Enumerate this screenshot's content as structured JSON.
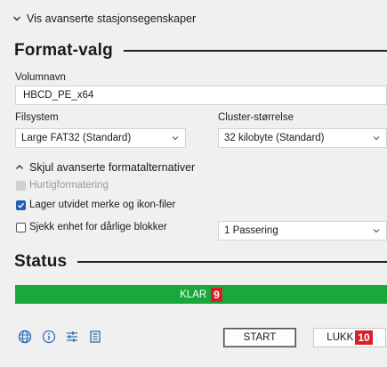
{
  "advanced_toggle": {
    "label": "Vis avanserte stasjonsegenskaper"
  },
  "format_section": {
    "title": "Format-valg"
  },
  "volume": {
    "label": "Volumnavn",
    "value": "HBCD_PE_x64"
  },
  "filesystem": {
    "label": "Filsystem",
    "value": "Large FAT32 (Standard)"
  },
  "cluster": {
    "label": "Cluster-størrelse",
    "value": "32 kilobyte (Standard)"
  },
  "advanced_format_toggle": {
    "label": "Skjul avanserte formatalternativer"
  },
  "options": {
    "quick_format": {
      "label": "Hurtigformatering",
      "checked": true,
      "enabled": false
    },
    "extended_label": {
      "label": "Lager utvidet merke og ikon-filer",
      "checked": true
    },
    "bad_blocks": {
      "label": "Sjekk enhet for dårlige blokker",
      "checked": false
    },
    "passes": {
      "value": "1 Passering"
    }
  },
  "status_section": {
    "title": "Status"
  },
  "status": {
    "text": "KLAR",
    "badge": "9",
    "progress": 1.0,
    "color": "#18a83c"
  },
  "toolbar": {
    "icons": [
      "globe-icon",
      "info-icon",
      "settings-sliders-icon",
      "log-icon"
    ]
  },
  "buttons": {
    "start": "START",
    "close": "LUKK",
    "close_badge": "10"
  },
  "colors": {
    "accent": "#1f5fb4",
    "badge": "#d81f26"
  }
}
